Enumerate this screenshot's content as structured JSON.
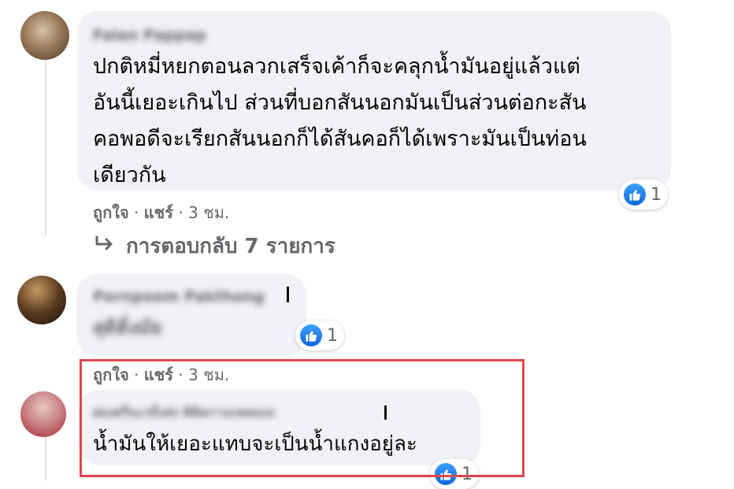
{
  "comments": [
    {
      "author": "Falan Pappap",
      "lines": [
        "ปกติหมี่หยกตอนลวกเสร็จเค้าก็จะคลุกน้ำมันอยู่แล้วแต่",
        "อันนี้เยอะเกินไป ส่วนที่บอกสันนอกมันเป็นส่วนต่อกะสัน",
        "คอพอดีจะเรียกสันนอกก็ได้สันคอก็ได้เพราะมันเป็นท่อน",
        "เดียวกัน"
      ],
      "reaction_count": "1",
      "actions": {
        "like": "ถูกใจ",
        "share": "แชร์",
        "sep": " · ",
        "time": "3 ชม."
      },
      "replies_label": "การตอบกลับ 7 รายการ"
    },
    {
      "author": "Pornpoom Pakthong",
      "text": "สุดิดิ่งมัย",
      "reaction_count": "1",
      "actions": {
        "like": "ถูกใจ",
        "share": "แชร์",
        "sep": " · ",
        "time": "3 ชม."
      }
    },
    {
      "author": "ผ่องศรีนะรถิ่งส่ง ติดิดกานกดดองง",
      "text": "น้ำมันให้เยอะแทบจะเป็นน้ำแกงอยู่ละ",
      "reaction_count": "1"
    }
  ],
  "colors": {
    "bubble": "#f0f2f5",
    "like_blue": "#1877f2",
    "meta_gray": "#65676b",
    "highlight_red": "#e0474c"
  },
  "icons": [
    "thumbs-up-icon",
    "reply-arrow-icon"
  ]
}
